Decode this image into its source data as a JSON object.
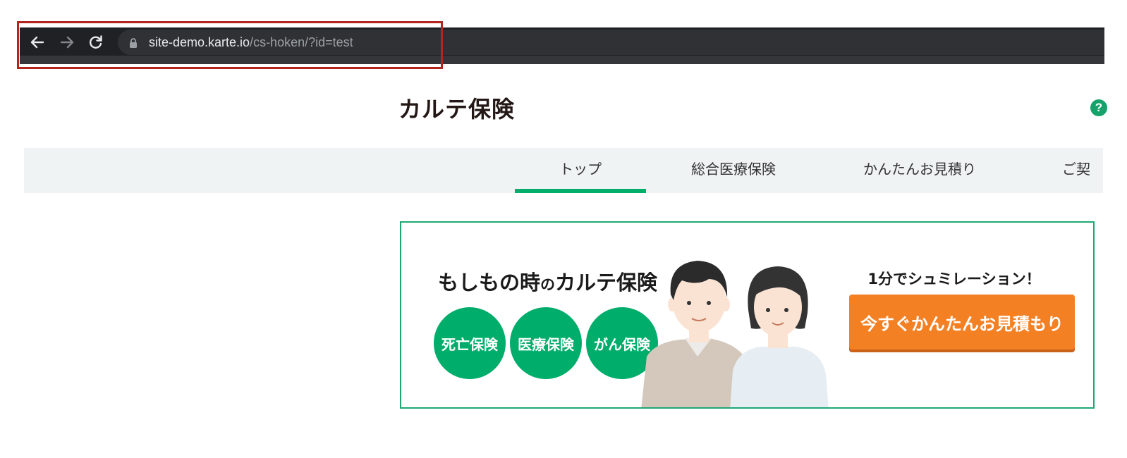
{
  "browser": {
    "url_host": "site-demo.karte.io",
    "url_path": "/cs-hoken/?id=test",
    "icons": [
      "back-arrow-icon",
      "forward-arrow-icon",
      "reload-icon",
      "lock-icon"
    ]
  },
  "site": {
    "title": "カルテ保険",
    "help_symbol": "?"
  },
  "nav": {
    "tabs": [
      {
        "label": "トップ",
        "active": true
      },
      {
        "label": "総合医療保険",
        "active": false
      },
      {
        "label": "かんたんお見積り",
        "active": false
      },
      {
        "label": "ご契",
        "active": false
      }
    ]
  },
  "banner": {
    "heading_part1": "もしもの時",
    "heading_small": "の",
    "heading_part2": "カルテ保険",
    "circles": [
      "死亡保険",
      "医療保険",
      "がん保険"
    ],
    "sim_text": "1分でシュミレーション！",
    "cta_label": "今すぐかんたんお見積もり"
  },
  "colors": {
    "brand_green": "#00ad6a",
    "cta_orange": "#f48024",
    "highlight_red": "#b3261e",
    "browser_dark": "#202124"
  }
}
